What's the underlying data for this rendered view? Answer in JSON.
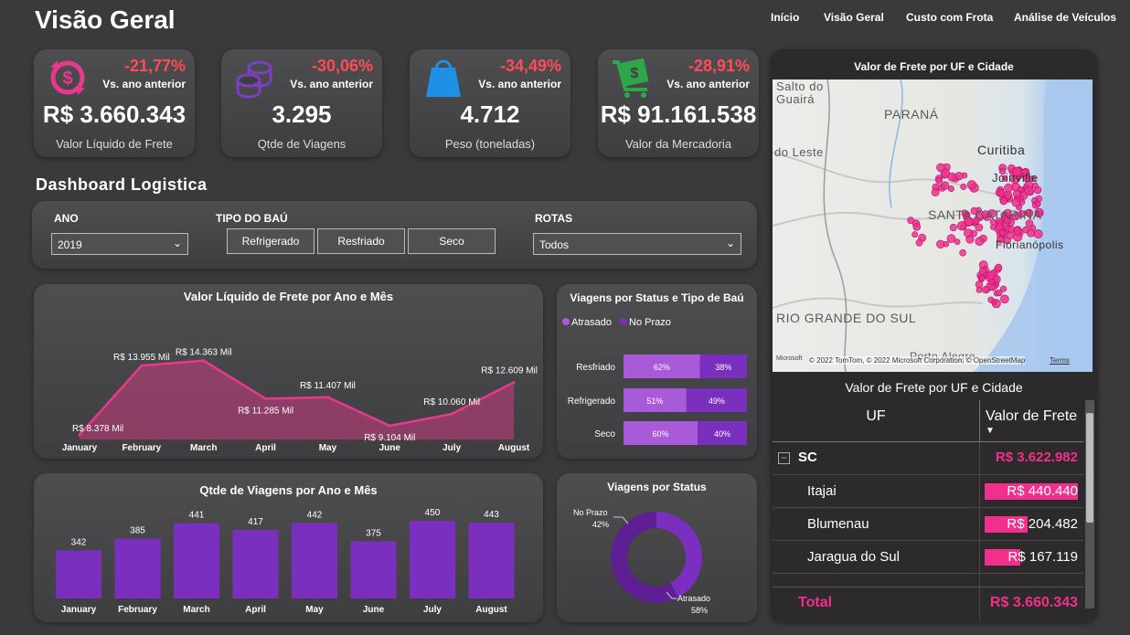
{
  "header": {
    "title": "Visão Geral",
    "nav": [
      "Início",
      "Visão Geral",
      "Custo com Frota",
      "Análise de Veículos"
    ]
  },
  "kpis": [
    {
      "delta": "-21,77%",
      "sub": "Vs. ano anterior",
      "value": "R$ 3.660.343",
      "label": "Valor Líquido de Frete",
      "icon": "money-exchange-icon",
      "color": "#e8398e"
    },
    {
      "delta": "-30,06%",
      "sub": "Vs. ano anterior",
      "value": "3.295",
      "label": "Qtde de Viagens",
      "icon": "coins-stack-icon",
      "color": "#7c3fbf"
    },
    {
      "delta": "-34,49%",
      "sub": "Vs. ano anterior",
      "value": "4.712",
      "label": "Peso (toneladas)",
      "icon": "weight-bag-icon",
      "color": "#1e90e6"
    },
    {
      "delta": "-28,91%",
      "sub": "Vs. ano anterior",
      "value": "R$ 91.161.538",
      "label": "Valor da Mercadoria",
      "icon": "cash-cart-icon",
      "color": "#2fa64a"
    }
  ],
  "dashboard_title": "Dashboard Logistica",
  "filters": {
    "ano_label": "ANO",
    "ano_value": "2019",
    "tipo_label": "TIPO DO BAÚ",
    "tipo_buttons": [
      "Refrigerado",
      "Resfriado",
      "Seco"
    ],
    "rotas_label": "ROTAS",
    "rotas_value": "Todos"
  },
  "charts": {
    "valor_title": "Valor Líquido de Frete por Ano e Mês",
    "viagens_title": "Qtde de Viagens por Ano e Mês",
    "status_tipo_title": "Viagens por Status e Tipo de Baú",
    "status_title": "Viagens por Status",
    "map_title": "Valor de Frete por UF e Cidade",
    "table_title": "Valor de Frete por UF e Cidade"
  },
  "chart_data": [
    {
      "type": "area",
      "title": "Valor Líquido de Frete por Ano e Mês",
      "categories": [
        "January",
        "February",
        "March",
        "April",
        "May",
        "June",
        "July",
        "August"
      ],
      "values": [
        8378,
        13955,
        14363,
        11285,
        11407,
        9104,
        10060,
        12609
      ],
      "labels": [
        "R$ 8.378 Mil",
        "R$ 13.955 Mil",
        "R$ 14.363 Mil",
        "R$ 11.285 Mil",
        "R$ 11.407 Mil",
        "R$ 9.104 Mil",
        "R$ 10.060 Mil",
        "R$ 12.609 Mil"
      ],
      "color": "#e8398e"
    },
    {
      "type": "bar",
      "title": "Qtde de Viagens por Ano e Mês",
      "categories": [
        "January",
        "February",
        "March",
        "April",
        "May",
        "June",
        "July",
        "August"
      ],
      "values": [
        342,
        385,
        441,
        417,
        442,
        375,
        450,
        443
      ],
      "color": "#7b2fbe"
    },
    {
      "type": "bar",
      "title": "Viagens por Status e Tipo de Baú",
      "legend": [
        "Atrasado",
        "No Prazo"
      ],
      "categories": [
        "Resfriado",
        "Refrigerado",
        "Seco"
      ],
      "series": [
        {
          "name": "Atrasado",
          "values": [
            62,
            51,
            60
          ]
        },
        {
          "name": "No Prazo",
          "values": [
            38,
            49,
            40
          ]
        }
      ],
      "value_labels": [
        [
          "62%",
          "38%"
        ],
        [
          "51%",
          "49%"
        ],
        [
          "60%",
          "40%"
        ]
      ],
      "colors": [
        "#a95ad8",
        "#7b2fbe"
      ]
    },
    {
      "type": "pie",
      "title": "Viagens por Status",
      "slices": [
        {
          "name": "No Prazo",
          "value": 42,
          "label": "42%"
        },
        {
          "name": "Atrasado",
          "value": 58,
          "label": "58%"
        }
      ],
      "colors": [
        "#7b2fbe",
        "#5e1f94"
      ]
    }
  ],
  "map": {
    "labels": [
      "Salto do",
      "Guairá",
      "PARANÁ",
      "do Leste",
      "Curitiba",
      "Joinville",
      "SANTA CATARINA",
      "Florianópolis",
      "RIO GRANDE DO SUL",
      "Porto Alegre"
    ],
    "attribution": "© 2022 TomTom, © 2022 Microsoft Corporation, © OpenStreetMap",
    "terms": "Terms",
    "logo": "Microsoft"
  },
  "table": {
    "col_uf": "UF",
    "col_valor": "Valor de Frete",
    "group": {
      "name": "SC",
      "value": "R$ 3.622.982"
    },
    "rows": [
      {
        "city": "Itajai",
        "value": "R$ 440.440",
        "ratio": 1.0
      },
      {
        "city": "Blumenau",
        "value": "R$ 204.482",
        "ratio": 0.46
      },
      {
        "city": "Jaragua do Sul",
        "value": "R$ 167.119",
        "ratio": 0.38
      }
    ],
    "total_label": "Total",
    "total_value": "R$ 3.660.343"
  }
}
